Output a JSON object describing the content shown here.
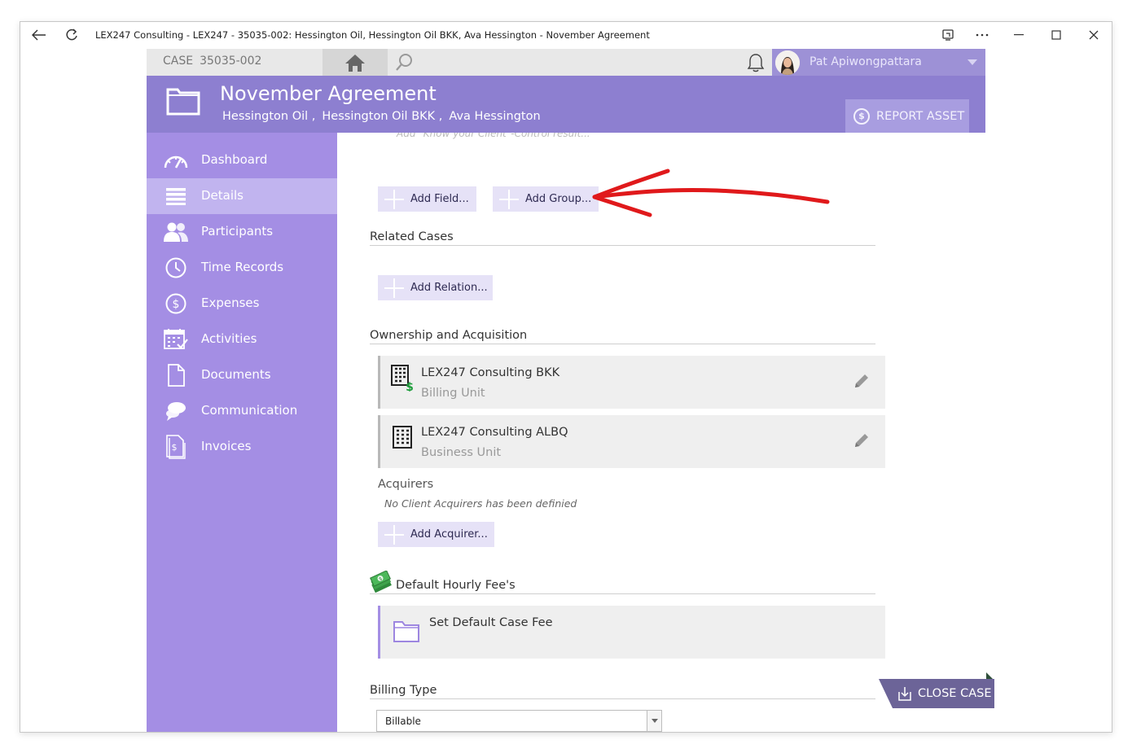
{
  "window": {
    "title": "LEX247 Consulting - LEX247 - 35035-002: Hessington Oil, Hessington Oil BKK, Ava Hessington - November Agreement"
  },
  "topbar": {
    "case_label": "CASE",
    "case_number": "35035-002",
    "user_name": "Pat Apiwongpattara"
  },
  "header": {
    "title": "November Agreement",
    "parties": [
      "Hessington Oil ,",
      "Hessington Oil BKK ,",
      "Ava Hessington"
    ],
    "report_asset_label": "REPORT ASSET"
  },
  "sidebar": {
    "items": [
      {
        "label": "Dashboard",
        "icon": "gauge-icon"
      },
      {
        "label": "Details",
        "icon": "list-icon"
      },
      {
        "label": "Participants",
        "icon": "people-icon"
      },
      {
        "label": "Time Records",
        "icon": "clock-icon"
      },
      {
        "label": "Expenses",
        "icon": "dollar-circle-icon"
      },
      {
        "label": "Activities",
        "icon": "calendar-check-icon"
      },
      {
        "label": "Documents",
        "icon": "document-icon"
      },
      {
        "label": "Communication",
        "icon": "chat-bubbles-icon"
      },
      {
        "label": "Invoices",
        "icon": "invoice-icon"
      }
    ],
    "active_index": 1
  },
  "content": {
    "cut_text": "Add \"Know your Client\"-Control result...",
    "add_field_label": "Add Field...",
    "add_group_label": "Add Group...",
    "related_cases_title": "Related Cases",
    "add_relation_label": "Add Relation...",
    "ownership_title": "Ownership and Acquisition",
    "ownership_cards": [
      {
        "title": "LEX247 Consulting BKK",
        "subtitle": "Billing Unit"
      },
      {
        "title": "LEX247 Consulting ALBQ",
        "subtitle": "Business Unit"
      }
    ],
    "acquirers_label": "Acquirers",
    "no_acquirers_text": "No Client Acquirers has been definied",
    "add_acquirer_label": "Add Acquirer...",
    "hourly_fee_title": "Default Hourly Fee's",
    "set_fee_label": "Set Default Case Fee",
    "billing_type_title": "Billing Type",
    "billing_type_value": "Billable"
  },
  "close_case_label": "CLOSE CASE",
  "colors": {
    "header_purple": "#8d7fd0",
    "sidebar_purple": "#a48ee4",
    "active_item": "#c1b4ef",
    "annotation_red": "#e0191b"
  }
}
